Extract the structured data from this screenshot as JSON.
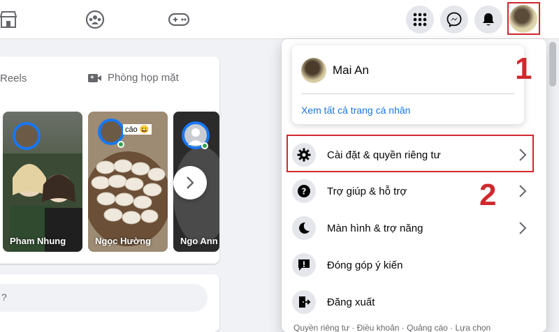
{
  "topbar": {
    "nav_icons": [
      "marketplace-icon",
      "groups-icon",
      "gaming-icon"
    ],
    "right_buttons": [
      "menu-grid-icon",
      "messenger-icon",
      "notifications-icon"
    ]
  },
  "feed": {
    "tabs": {
      "reels": "Reels",
      "meeting": "Phòng họp mặt"
    },
    "stories": [
      {
        "name": "Pham Nhung"
      },
      {
        "name": "Ngọc Hường",
        "caption": "cảo 😀"
      },
      {
        "name": "Ngo Ann"
      }
    ]
  },
  "account_menu": {
    "profile": {
      "name": "Mai An",
      "view_all_link": "Xem tất cả trang cá nhân"
    },
    "items": [
      {
        "label": "Cài đặt & quyền riêng tư",
        "icon": "gear-icon",
        "has_arrow": true
      },
      {
        "label": "Trợ giúp & hỗ trợ",
        "icon": "help-icon",
        "has_arrow": true
      },
      {
        "label": "Màn hình & trợ năng",
        "icon": "moon-icon",
        "has_arrow": true
      },
      {
        "label": "Đóng góp ý kiến",
        "icon": "feedback-icon",
        "has_arrow": false
      },
      {
        "label": "Đăng xuất",
        "icon": "logout-icon",
        "has_arrow": false
      }
    ],
    "footer": "Quyền riêng tư · Điều khoản · Quảng cáo · Lựa chọn"
  },
  "annotations": {
    "step1": "1",
    "step2": "2",
    "color": "#d0282e"
  }
}
